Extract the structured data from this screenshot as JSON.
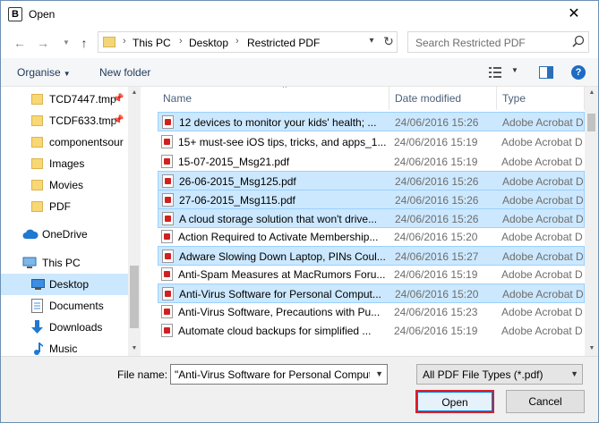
{
  "window": {
    "title": "Open",
    "app_icon_letter": "B",
    "close_glyph": "✕"
  },
  "address": {
    "crumbs": [
      "This PC",
      "Desktop",
      "Restricted PDF"
    ],
    "search_placeholder": "Search Restricted PDF"
  },
  "toolbar": {
    "organise": "Organise",
    "new_folder": "New folder",
    "help": "?"
  },
  "nav": {
    "items": [
      {
        "label": "TCD7447.tmp",
        "icon": "folder-icon",
        "pinned": true
      },
      {
        "label": "TCDF633.tmp",
        "icon": "folder-icon",
        "pinned": true
      },
      {
        "label": "componentsour",
        "icon": "folder-icon",
        "pinned": false
      },
      {
        "label": "Images",
        "icon": "folder-icon",
        "pinned": false
      },
      {
        "label": "Movies",
        "icon": "folder-icon",
        "pinned": false
      },
      {
        "label": "PDF",
        "icon": "folder-icon",
        "pinned": false
      },
      {
        "label": "OneDrive",
        "icon": "cloud-icon",
        "pinned": false
      },
      {
        "label": "This PC",
        "icon": "computer-icon",
        "pinned": false
      },
      {
        "label": "Desktop",
        "icon": "desktop-icon",
        "pinned": false,
        "selected": true
      },
      {
        "label": "Documents",
        "icon": "documents-icon",
        "pinned": false
      },
      {
        "label": "Downloads",
        "icon": "downloads-icon",
        "pinned": false
      },
      {
        "label": "Music",
        "icon": "music-icon",
        "pinned": false
      }
    ]
  },
  "files": {
    "columns": {
      "name": "Name",
      "date": "Date modified",
      "type": "Type"
    },
    "rows": [
      {
        "name": "12 devices to monitor your kids' health; ...",
        "date": "24/06/2016 15:26",
        "type": "Adobe Acrobat D",
        "selected": true
      },
      {
        "name": "15+ must-see iOS tips, tricks, and apps_1...",
        "date": "24/06/2016 15:19",
        "type": "Adobe Acrobat D",
        "selected": false
      },
      {
        "name": "15-07-2015_Msg21.pdf",
        "date": "24/06/2016 15:19",
        "type": "Adobe Acrobat D",
        "selected": false
      },
      {
        "name": "26-06-2015_Msg125.pdf",
        "date": "24/06/2016 15:26",
        "type": "Adobe Acrobat D",
        "selected": true
      },
      {
        "name": "27-06-2015_Msg115.pdf",
        "date": "24/06/2016 15:26",
        "type": "Adobe Acrobat D",
        "selected": true
      },
      {
        "name": "A cloud storage solution that won't drive...",
        "date": "24/06/2016 15:26",
        "type": "Adobe Acrobat D",
        "selected": true
      },
      {
        "name": "Action Required to Activate Membership...",
        "date": "24/06/2016 15:20",
        "type": "Adobe Acrobat D",
        "selected": false
      },
      {
        "name": "Adware Slowing Down Laptop, PINs Coul...",
        "date": "24/06/2016 15:27",
        "type": "Adobe Acrobat D",
        "selected": true
      },
      {
        "name": "Anti-Spam Measures at MacRumors Foru...",
        "date": "24/06/2016 15:19",
        "type": "Adobe Acrobat D",
        "selected": false
      },
      {
        "name": "Anti-Virus Software for Personal Comput...",
        "date": "24/06/2016 15:20",
        "type": "Adobe Acrobat D",
        "selected": true
      },
      {
        "name": "Anti-Virus Software, Precautions with Pu...",
        "date": "24/06/2016 15:23",
        "type": "Adobe Acrobat D",
        "selected": false
      },
      {
        "name": "Automate cloud backups for simplified ...",
        "date": "24/06/2016 15:19",
        "type": "Adobe Acrobat D",
        "selected": false
      }
    ]
  },
  "footer": {
    "file_name_label": "File name:",
    "file_name_value": "\"Anti-Virus Software for Personal Computing",
    "file_type_value": "All PDF File Types (*.pdf)",
    "open_label": "Open",
    "cancel_label": "Cancel"
  }
}
